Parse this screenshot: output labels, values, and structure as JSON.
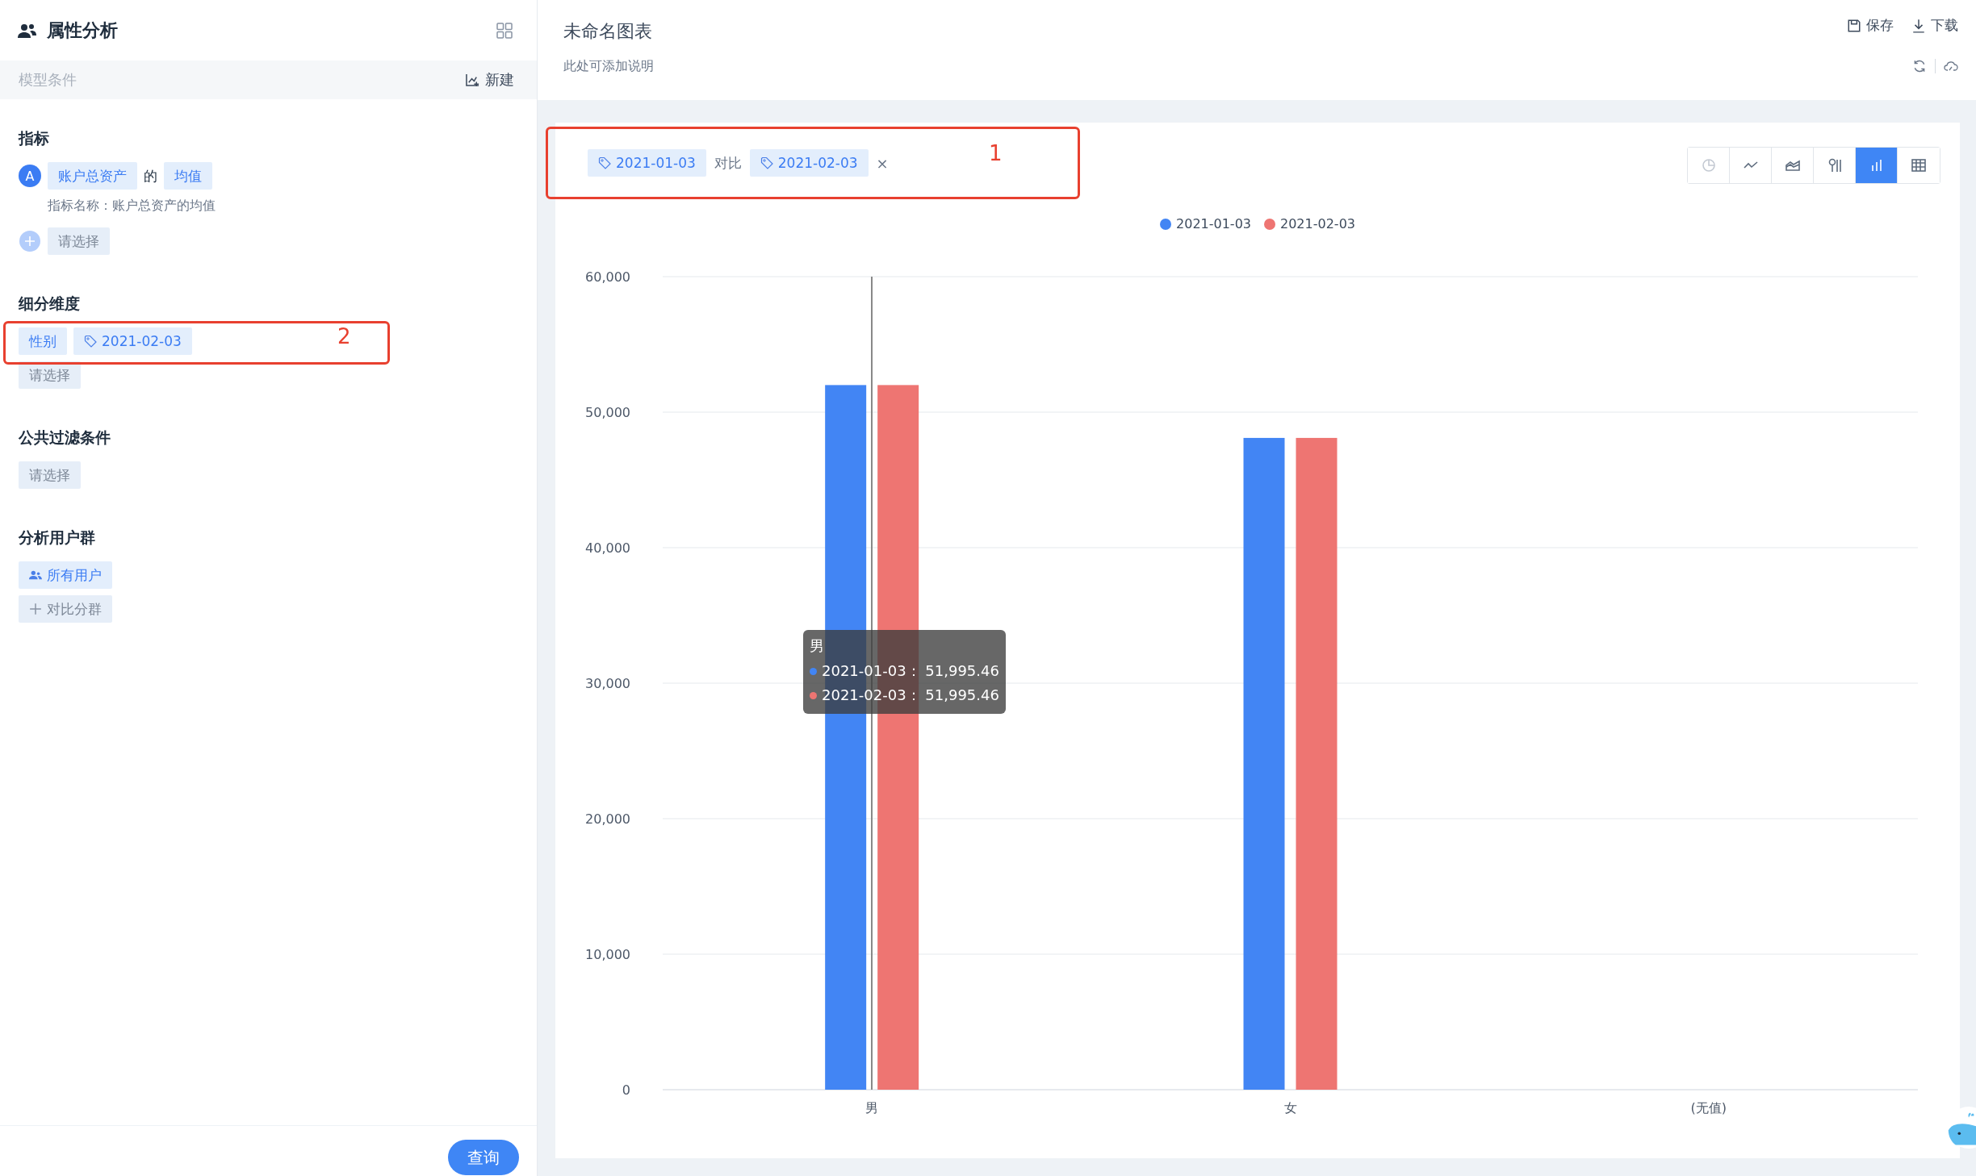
{
  "sidebar": {
    "title": "属性分析",
    "conditions_label": "模型条件",
    "new_button": "新建",
    "metrics": {
      "heading": "指标",
      "items": [
        {
          "badge": "A",
          "field": "账户总资产",
          "joiner": "的",
          "aggregate": "均值",
          "caption": "指标名称：账户总资产的均值"
        }
      ],
      "add_placeholder": "请选择"
    },
    "dimensions": {
      "heading": "细分维度",
      "tags": [
        {
          "kind": "plain",
          "label": "性别"
        },
        {
          "kind": "tag",
          "label": "2021-02-03"
        }
      ],
      "add_placeholder": "请选择",
      "annotation": "2"
    },
    "filters": {
      "heading": "公共过滤条件",
      "add_placeholder": "请选择"
    },
    "segments": {
      "heading": "分析用户群",
      "items": [
        {
          "label": "所有用户"
        }
      ],
      "compare_button": "对比分群"
    },
    "query_button": "查询"
  },
  "chart_panel": {
    "title": "未命名图表",
    "description": "此处可添加说明",
    "save": "保存",
    "download": "下载",
    "compare": {
      "base": "2021-01-03",
      "joiner": "对比",
      "target": "2021-02-03",
      "remove": "×",
      "annotation": "1"
    },
    "chart_types": [
      {
        "kind": "pie",
        "selected": false
      },
      {
        "kind": "line",
        "selected": false
      },
      {
        "kind": "area",
        "selected": false
      },
      {
        "kind": "funnel",
        "selected": false
      },
      {
        "kind": "bar",
        "selected": true
      },
      {
        "kind": "table",
        "selected": false
      }
    ],
    "tooltip": {
      "title": "男",
      "rows": [
        {
          "text": "2021-01-03： 51,995.46"
        },
        {
          "text": "2021-02-03： 51,995.46"
        }
      ]
    },
    "chart_data": {
      "type": "bar",
      "categories": [
        "男",
        "女",
        "(无值)"
      ],
      "series": [
        {
          "name": "2021-01-03",
          "color": "#4285f4",
          "values": [
            52000,
            48100,
            null
          ]
        },
        {
          "name": "2021-02-03",
          "color": "#ee7572",
          "values": [
            52000,
            48100,
            null
          ]
        }
      ],
      "grid": true,
      "ylim": [
        0,
        60000
      ],
      "yticks": [
        {
          "value": 0,
          "label": "0"
        },
        {
          "value": 10000,
          "label": "10,000"
        },
        {
          "value": 20000,
          "label": "20,000"
        },
        {
          "value": 30000,
          "label": "30,000"
        },
        {
          "value": 40000,
          "label": "40,000"
        },
        {
          "value": 50000,
          "label": "50,000"
        },
        {
          "value": 60000,
          "label": "60,000"
        }
      ]
    }
  }
}
